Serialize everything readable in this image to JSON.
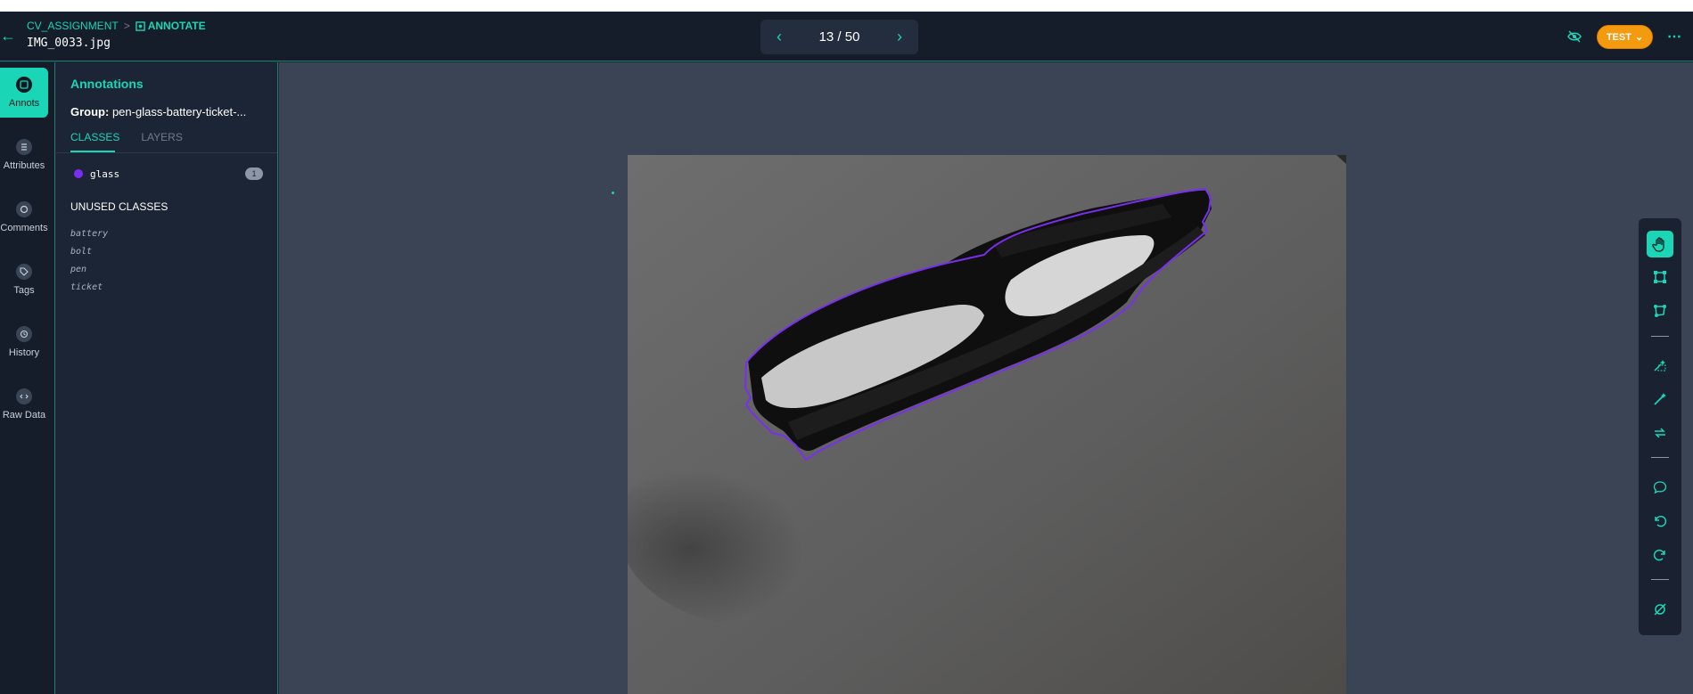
{
  "header": {
    "breadcrumb_project": "CV_ASSIGNMENT",
    "breadcrumb_sep": ">",
    "breadcrumb_current": "ANNOTATE",
    "filename": "IMG_0033.jpg",
    "pager": "13 / 50",
    "env_button": "TEST"
  },
  "rail": {
    "items": [
      {
        "label": "Annots",
        "icon": "annotations-icon"
      },
      {
        "label": "Attributes",
        "icon": "list-icon"
      },
      {
        "label": "Comments",
        "icon": "comment-icon"
      },
      {
        "label": "Tags",
        "icon": "tag-icon"
      },
      {
        "label": "History",
        "icon": "history-icon"
      },
      {
        "label": "Raw Data",
        "icon": "code-icon"
      }
    ]
  },
  "panel": {
    "title": "Annotations",
    "group_label": "Group:",
    "group_value": "pen-glass-battery-ticket-...",
    "tabs": [
      "CLASSES",
      "LAYERS"
    ],
    "classes": [
      {
        "name": "glass",
        "count": "1",
        "color": "#7a2ff0"
      }
    ],
    "unused_title": "UNUSED CLASSES",
    "unused": [
      "battery",
      "bolt",
      "pen",
      "ticket"
    ]
  },
  "colors": {
    "accent": "#1bd6b6",
    "env_button": "#f39a0f",
    "annotation_outline": "#7a2ff0"
  },
  "tools": [
    "hand-icon",
    "bounding-box-icon",
    "polygon-icon",
    "smart-select-icon",
    "magic-wand-icon",
    "swap-icon",
    "comment-icon",
    "undo-icon",
    "redo-icon",
    "clear-icon"
  ]
}
